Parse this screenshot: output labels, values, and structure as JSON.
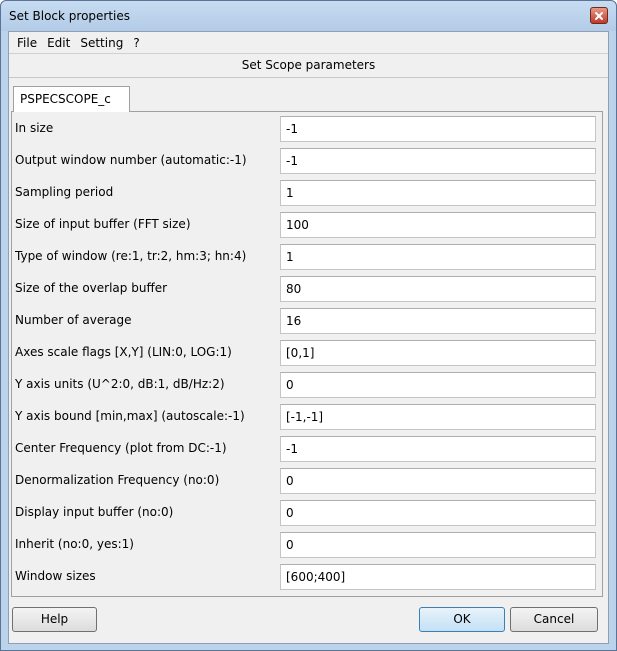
{
  "window": {
    "title": "Set Block properties"
  },
  "menu": [
    {
      "label": "File"
    },
    {
      "label": "Edit"
    },
    {
      "label": "Setting"
    },
    {
      "label": "?"
    }
  ],
  "header": "Set Scope parameters",
  "tab": {
    "label": "PSPECSCOPE_c"
  },
  "params": [
    {
      "label": "In size",
      "value": "-1"
    },
    {
      "label": "Output window number (automatic:-1)",
      "value": "-1"
    },
    {
      "label": "Sampling period",
      "value": "1"
    },
    {
      "label": "Size of input buffer (FFT size)",
      "value": "100"
    },
    {
      "label": "Type of window (re:1, tr:2, hm:3; hn:4)",
      "value": "1"
    },
    {
      "label": "Size of the overlap buffer",
      "value": "80"
    },
    {
      "label": "Number of average",
      "value": "16"
    },
    {
      "label": "Axes scale flags [X,Y] (LIN:0, LOG:1)",
      "value": "[0,1]"
    },
    {
      "label": "Y axis units (U^2:0, dB:1, dB/Hz:2)",
      "value": "0"
    },
    {
      "label": "Y axis bound [min,max] (autoscale:-1)",
      "value": "[-1,-1]"
    },
    {
      "label": "Center Frequency (plot from DC:-1)",
      "value": "-1"
    },
    {
      "label": "Denormalization Frequency (no:0)",
      "value": "0"
    },
    {
      "label": "Display input buffer (no:0)",
      "value": "0"
    },
    {
      "label": "Inherit (no:0, yes:1)",
      "value": "0"
    },
    {
      "label": "Window sizes",
      "value": "[600;400]"
    }
  ],
  "buttons": {
    "help": "Help",
    "ok": "OK",
    "cancel": "Cancel"
  },
  "colors": {
    "titlebar": "#c7dcf1",
    "close": "#c0392b",
    "ok_border": "#3c7fb1"
  }
}
